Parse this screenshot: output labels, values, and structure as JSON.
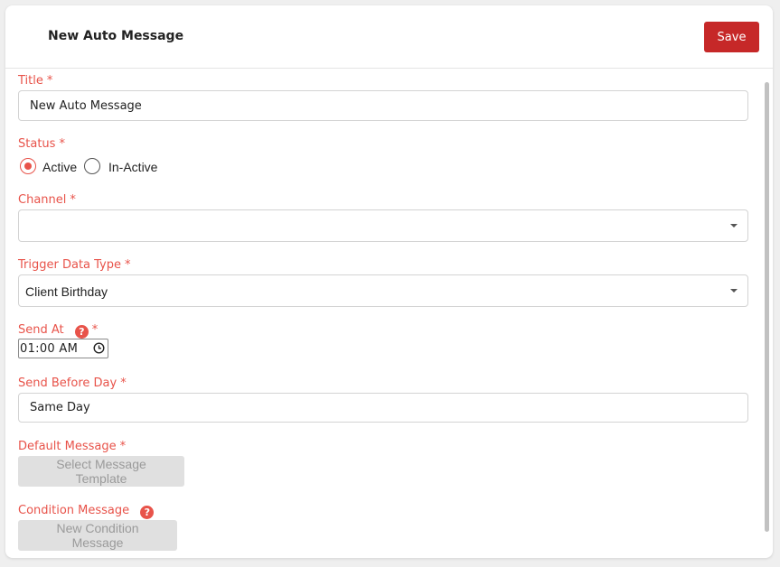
{
  "header": {
    "title": "New Auto Message",
    "save_label": "Save"
  },
  "form": {
    "title": {
      "label": "Title",
      "required": "*",
      "value": "New Auto Message"
    },
    "status": {
      "label": "Status",
      "required": "*",
      "options": [
        {
          "label": "Active",
          "selected": true
        },
        {
          "label": "In-Active",
          "selected": false
        }
      ]
    },
    "channel": {
      "label": "Channel",
      "required": "*",
      "value": ""
    },
    "trigger_data_type": {
      "label": "Trigger Data Type",
      "required": "*",
      "value": "Client Birthday"
    },
    "send_at": {
      "label": "Send At",
      "required": "*",
      "help": "?",
      "value": "01:00 AM"
    },
    "send_before_day": {
      "label": "Send Before Day",
      "required": "*",
      "value": "Same Day"
    },
    "default_message": {
      "label": "Default Message",
      "required": "*",
      "button_label": "Select Message Template"
    },
    "condition_message": {
      "label": "Condition Message",
      "help": "?",
      "button_label": "New Condition Message"
    }
  },
  "colors": {
    "accent": "#e8534a",
    "save_button": "#c62828",
    "disabled_button": "#e0e0e0"
  },
  "icons": {
    "help": "question-circle-icon",
    "clock": "clock-icon",
    "dropdown": "caret-down-icon"
  }
}
